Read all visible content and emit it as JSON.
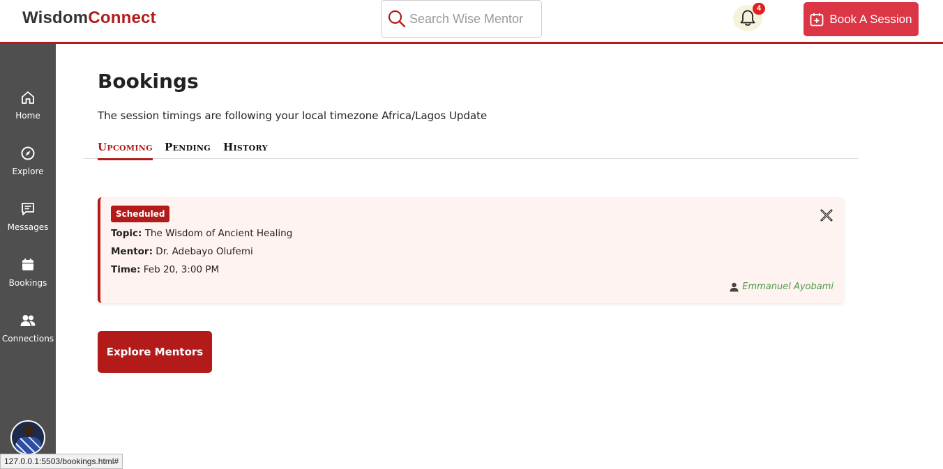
{
  "header": {
    "logo_part1": "Wisdom",
    "logo_part2": "Connect",
    "search_placeholder": "Search Wise Mentor",
    "notification_count": "4",
    "book_button": "Book A Session"
  },
  "sidebar": {
    "items": [
      {
        "label": "Home",
        "icon": "home-icon"
      },
      {
        "label": "Explore",
        "icon": "compass-icon"
      },
      {
        "label": "Messages",
        "icon": "message-icon"
      },
      {
        "label": "Bookings",
        "icon": "calendar-icon"
      },
      {
        "label": "Connections",
        "icon": "users-icon"
      }
    ]
  },
  "main": {
    "title": "Bookings",
    "timezone_note": "The session timings are following your local timezone Africa/Lagos Update",
    "tabs": [
      {
        "label": "Upcoming",
        "active": true
      },
      {
        "label": "Pending",
        "active": false
      },
      {
        "label": "History",
        "active": false
      }
    ],
    "booking": {
      "status": "Scheduled",
      "topic_label": "Topic:",
      "topic": "The Wisdom of Ancient Healing",
      "mentor_label": "Mentor:",
      "mentor": "Dr. Adebayo Olufemi",
      "time_label": "Time:",
      "time": "Feb 20, 3:00 PM",
      "mentee": "Emmanuel Ayobami"
    },
    "explore_button": "Explore Mentors"
  },
  "status_url": "127.0.0.1:5503/bookings.html#",
  "colors": {
    "brand": "#b31b1b",
    "book_button": "#dc3545",
    "sidebar": "#4f4f4f",
    "card_bg": "#fff3f2",
    "mentee_text": "#4a9a4a"
  }
}
